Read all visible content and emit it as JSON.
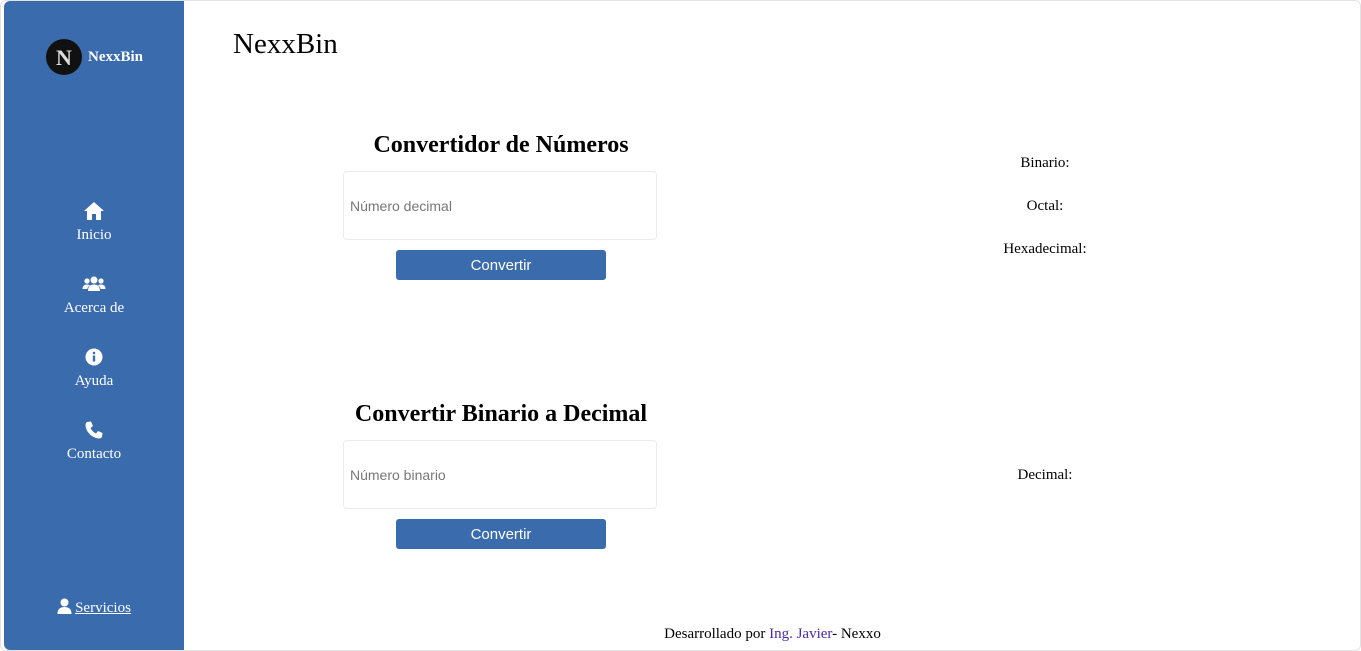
{
  "sidebar": {
    "brand": {
      "name": "NexxBin",
      "logo_letter": "N"
    },
    "items": [
      {
        "label": "Inicio",
        "icon": "home-icon"
      },
      {
        "label": "Acerca de",
        "icon": "users-icon"
      },
      {
        "label": "Ayuda",
        "icon": "info-icon"
      },
      {
        "label": "Contacto",
        "icon": "phone-icon"
      }
    ],
    "services": {
      "label": "Servicios",
      "icon": "user-icon"
    }
  },
  "main": {
    "title": "NexxBin",
    "decimal_converter": {
      "title": "Convertidor de Números",
      "input_placeholder": "Número decimal",
      "button_label": "Convertir",
      "results": [
        {
          "label": "Binario:"
        },
        {
          "label": "Octal:"
        },
        {
          "label": "Hexadecimal:"
        }
      ]
    },
    "binary_converter": {
      "title": "Convertir Binario a Decimal",
      "input_placeholder": "Número binario",
      "button_label": "Convertir",
      "results": [
        {
          "label": "Decimal:"
        }
      ]
    }
  },
  "footer": {
    "prefix": "Desarrollado por ",
    "author": "Ing. Javier",
    "suffix": "- Nexxo"
  },
  "colors": {
    "sidebar_bg": "#3a6bac",
    "button_bg": "#3a6bac",
    "author_link": "#4b2aa6"
  }
}
